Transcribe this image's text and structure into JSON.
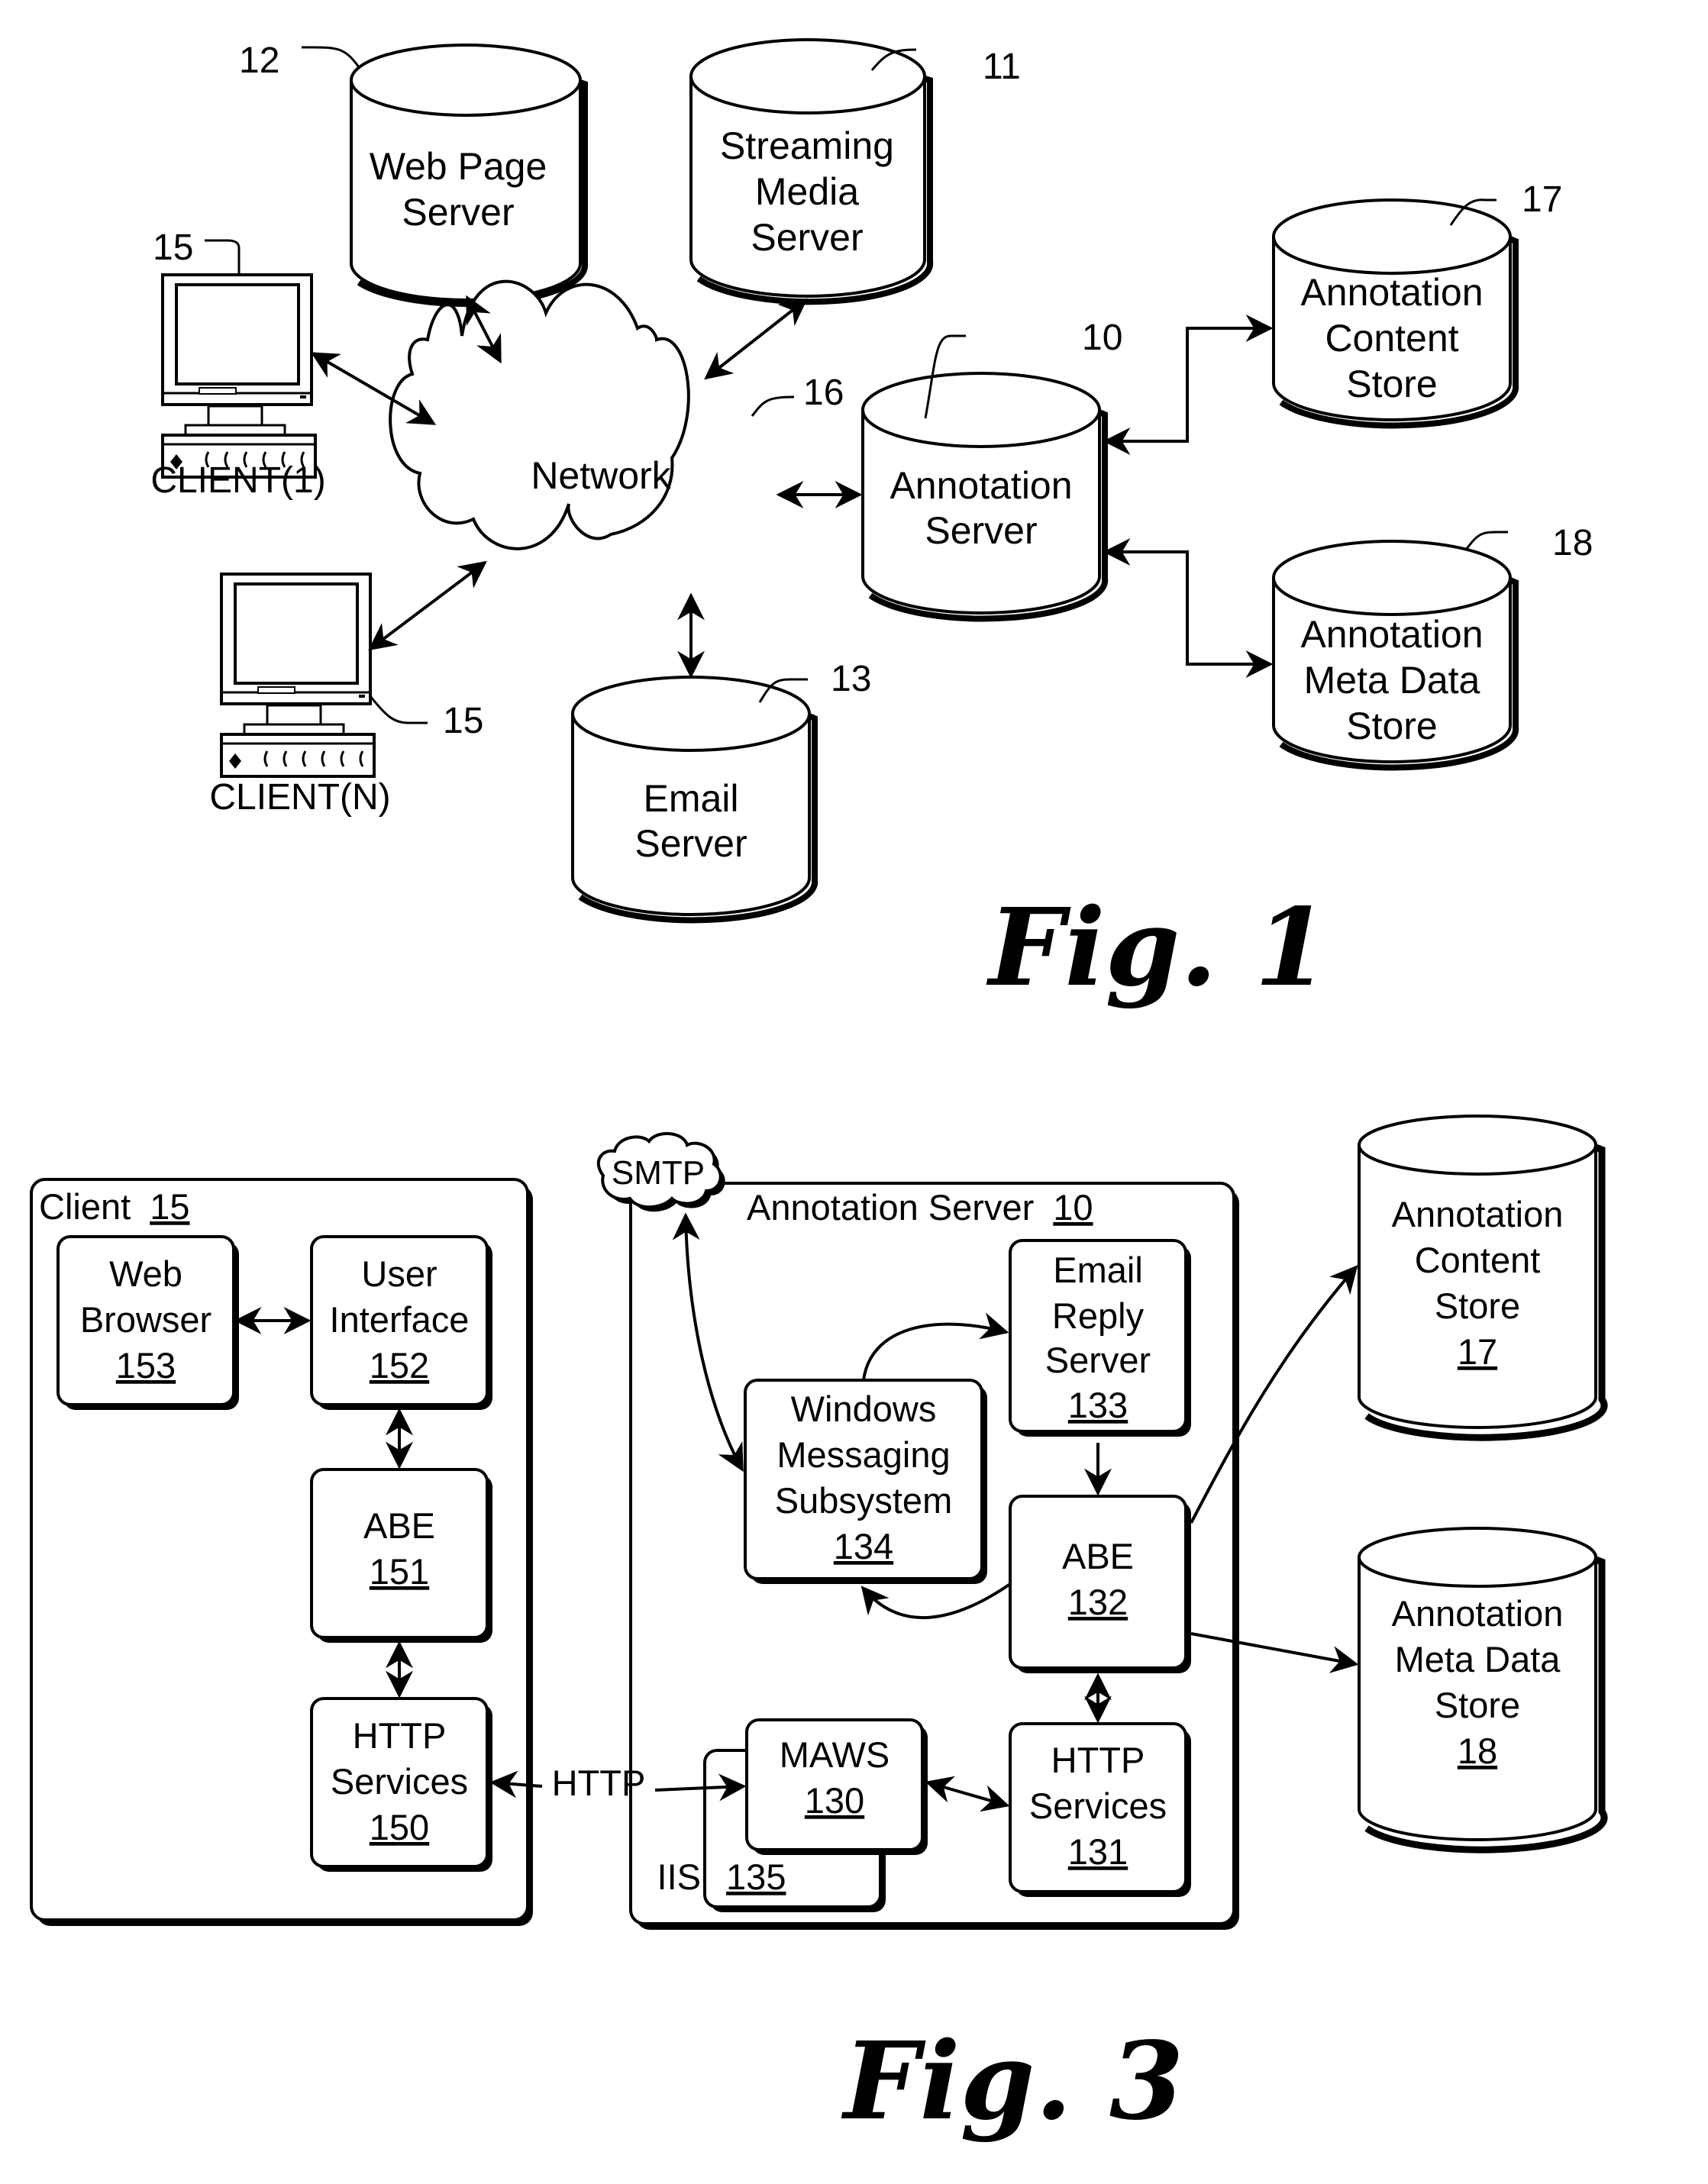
{
  "fig1": {
    "caption": "Fig. 1",
    "nodes": {
      "web_page_server": {
        "lines": [
          "Web Page",
          "Server"
        ],
        "ref": "12"
      },
      "streaming_media_server": {
        "lines": [
          "Streaming",
          "Media",
          "Server"
        ],
        "ref": "11"
      },
      "network": {
        "label": "Network",
        "ref": "16"
      },
      "annotation_server": {
        "lines": [
          "Annotation",
          "Server"
        ],
        "ref": "10"
      },
      "annotation_content_store": {
        "lines": [
          "Annotation",
          "Content",
          "Store"
        ],
        "ref": "17"
      },
      "annotation_meta_data_store": {
        "lines": [
          "Annotation",
          "Meta Data",
          "Store"
        ],
        "ref": "18"
      },
      "email_server": {
        "lines": [
          "Email",
          "Server"
        ],
        "ref": "13"
      },
      "client_1": {
        "label": "CLIENT(1)",
        "ref": "15"
      },
      "client_n": {
        "label": "CLIENT(N)",
        "ref": "15"
      }
    }
  },
  "fig3": {
    "caption": "Fig. 3",
    "client_frame": {
      "title": "Client",
      "ref": "15"
    },
    "server_frame": {
      "title": "Annotation Server",
      "ref": "10"
    },
    "smtp_cloud": {
      "label": "SMTP"
    },
    "http_link_label": "HTTP",
    "boxes": {
      "web_browser": {
        "lines": [
          "Web",
          "Browser"
        ],
        "ref": "153"
      },
      "user_interface": {
        "lines": [
          "User",
          "Interface"
        ],
        "ref": "152"
      },
      "client_abe": {
        "lines": [
          "ABE"
        ],
        "ref": "151"
      },
      "client_http_services": {
        "lines": [
          "HTTP",
          "Services"
        ],
        "ref": "150"
      },
      "email_reply_server": {
        "lines": [
          "Email",
          "Reply",
          "Server"
        ],
        "ref": "133"
      },
      "windows_messaging": {
        "lines": [
          "Windows",
          "Messaging",
          "Subsystem"
        ],
        "ref": "134"
      },
      "server_abe": {
        "lines": [
          "ABE"
        ],
        "ref": "132"
      },
      "maws": {
        "lines": [
          "MAWS"
        ],
        "ref": "130"
      },
      "iis": {
        "label": "IIS",
        "ref": "135"
      },
      "server_http_services": {
        "lines": [
          "HTTP",
          "Services"
        ],
        "ref": "131"
      }
    },
    "stores": {
      "annotation_content_store": {
        "lines": [
          "Annotation",
          "Content",
          "Store"
        ],
        "ref": "17"
      },
      "annotation_meta_data_store": {
        "lines": [
          "Annotation",
          "Meta Data",
          "Store"
        ],
        "ref": "18"
      }
    }
  }
}
